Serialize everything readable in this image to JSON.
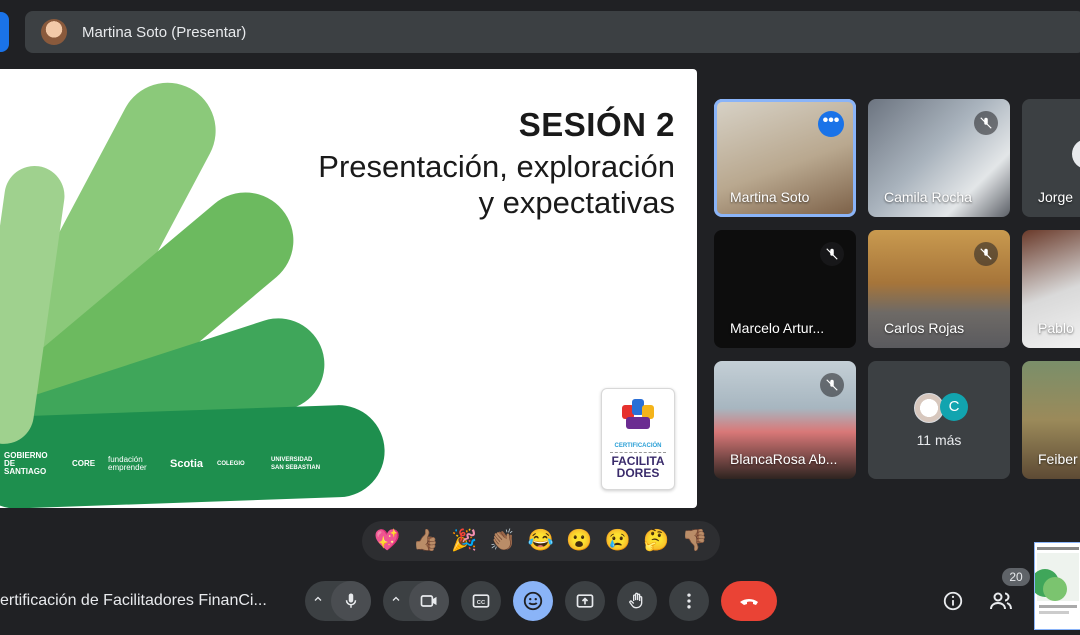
{
  "presenter": {
    "name": "Martina Soto (Presentar)"
  },
  "slide": {
    "title": "SESIÓN 2",
    "subtitle_line1": "Presentación, exploración",
    "subtitle_line2": "y expectativas",
    "logos": [
      "GOBIERNO DE SANTIAGO",
      "CORE",
      "fundación emprender",
      "Scotia",
      "COLEGIO",
      "UNIVERSIDAD SAN SEBASTIAN"
    ],
    "badge_top": "CERTIFICACIÓN",
    "badge_line1": "FACILITA",
    "badge_line2": "DORES"
  },
  "participants": [
    {
      "name": "Martina Soto"
    },
    {
      "name": "Camila Rocha"
    },
    {
      "name": "Jorge"
    },
    {
      "name": "Marcelo Artur..."
    },
    {
      "name": "Carlos Rojas"
    },
    {
      "name": "Pablo"
    },
    {
      "name": "BlancaRosa Ab..."
    },
    {
      "name": "Feiber"
    }
  ],
  "more": {
    "label": "11 más",
    "avatar_letter": "C"
  },
  "reactions": [
    "💖",
    "👍🏽",
    "🎉",
    "👏🏽",
    "😂",
    "😮",
    "😢",
    "🤔",
    "👎🏽"
  ],
  "bottom": {
    "meeting_title": "ertificación de Facilitadores FinanCi...",
    "participant_count": "20"
  },
  "colors": {
    "accent": "#1a73e8",
    "end_call": "#ea4335",
    "emoji_active": "#8ab4f8",
    "slide_green_dark": "#1e8f4e",
    "slide_green_light": "#7bc46f"
  }
}
